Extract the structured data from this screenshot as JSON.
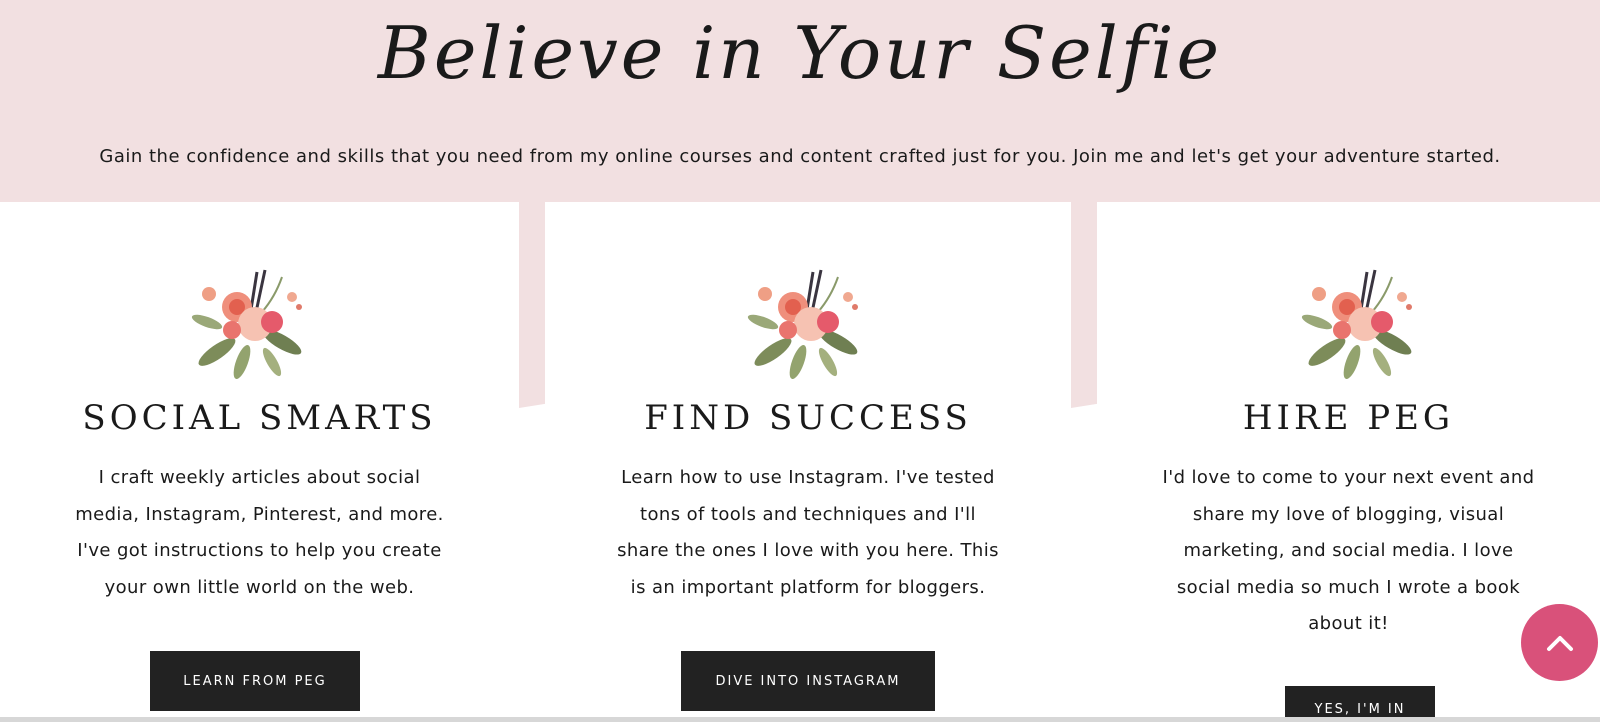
{
  "hero": {
    "title": "Believe in Your Selfie",
    "tagline": "Gain the confidence and skills that you need from my online courses and content crafted just for you. Join me and let's get your adventure started."
  },
  "cards": [
    {
      "title": "SOCIAL SMARTS",
      "lines": [
        "I craft weekly articles about social",
        "media, Instagram, Pinterest, and more.",
        "I've got instructions to help you create",
        "your own little world on the web."
      ],
      "button": "LEARN FROM PEG"
    },
    {
      "title": "FIND SUCCESS",
      "lines": [
        "Learn how to use Instagram. I've tested",
        "tons of tools and techniques and I'll",
        "share the ones I love with you here. This",
        "is an important platform for bloggers."
      ],
      "button": "DIVE INTO INSTAGRAM"
    },
    {
      "title": "HIRE PEG",
      "lines": [
        "I'd love to come to your next event and",
        "share my love of blogging, visual",
        "marketing, and social media. I love",
        "social media so much I wrote a book",
        "about it!"
      ],
      "button": "YES, I'M IN"
    }
  ],
  "icons": {
    "bouquet": "floral-bouquet-icon",
    "scroll_top": "chevron-up-icon"
  },
  "colors": {
    "hero_bg": "#f2e0e1",
    "button_bg": "#222222",
    "scroll_top_bg": "#d9517a"
  }
}
